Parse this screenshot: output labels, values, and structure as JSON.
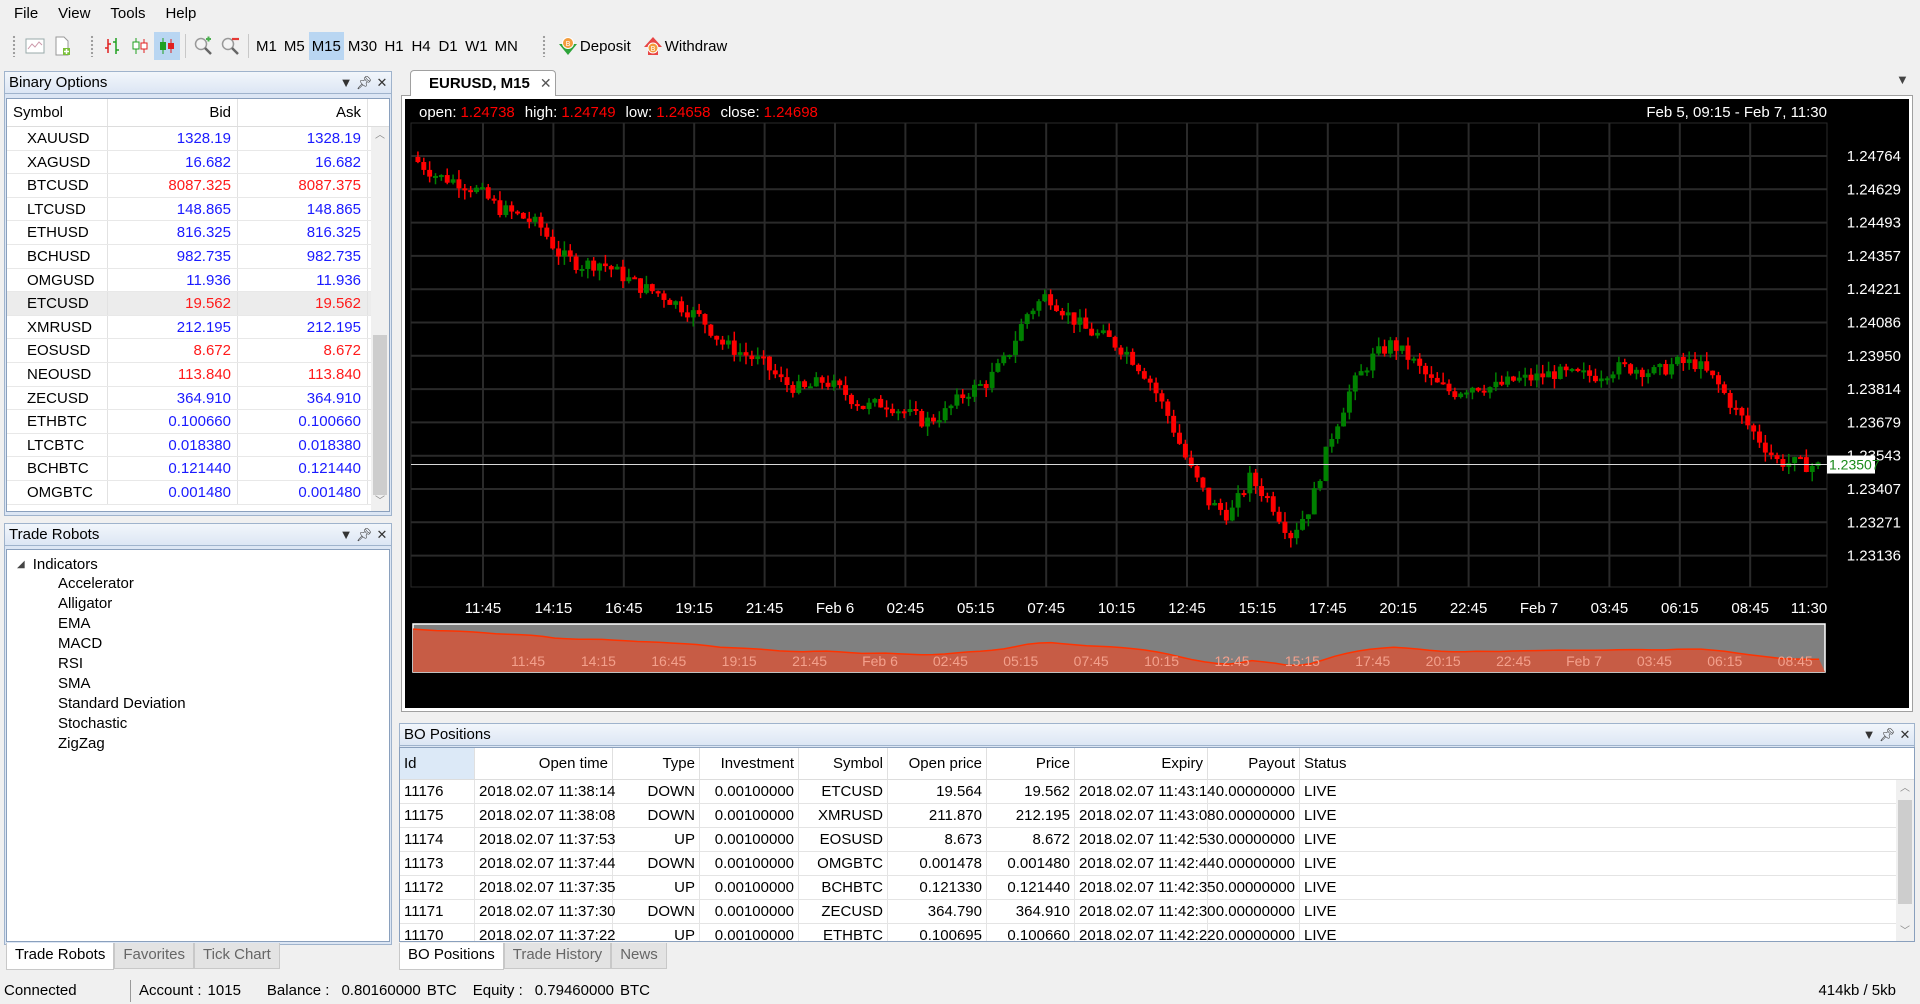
{
  "menu": [
    "File",
    "View",
    "Tools",
    "Help"
  ],
  "toolbar": {
    "icons": [
      "new-chart-icon",
      "new-file-icon",
      "bar-chart-icon",
      "candlestick-hollow-icon",
      "candlestick-icon",
      "zoom-in-icon",
      "zoom-out-icon"
    ],
    "timeframes": [
      "M1",
      "M5",
      "M15",
      "M30",
      "H1",
      "H4",
      "D1",
      "W1",
      "MN"
    ],
    "active_timeframe": "M15",
    "deposit_label": "Deposit",
    "withdraw_label": "Withdraw"
  },
  "binary_options": {
    "title": "Binary Options",
    "columns": [
      "Symbol",
      "Bid",
      "Ask"
    ],
    "selected_symbol": "ETCUSD",
    "rows": [
      {
        "symbol": "XAUUSD",
        "bid": "1328.19",
        "ask": "1328.19",
        "dir": "up"
      },
      {
        "symbol": "XAGUSD",
        "bid": "16.682",
        "ask": "16.682",
        "dir": "up"
      },
      {
        "symbol": "BTCUSD",
        "bid": "8087.325",
        "ask": "8087.375",
        "dir": "down"
      },
      {
        "symbol": "LTCUSD",
        "bid": "148.865",
        "ask": "148.865",
        "dir": "up"
      },
      {
        "symbol": "ETHUSD",
        "bid": "816.325",
        "ask": "816.325",
        "dir": "up"
      },
      {
        "symbol": "BCHUSD",
        "bid": "982.735",
        "ask": "982.735",
        "dir": "up"
      },
      {
        "symbol": "OMGUSD",
        "bid": "11.936",
        "ask": "11.936",
        "dir": "up"
      },
      {
        "symbol": "ETCUSD",
        "bid": "19.562",
        "ask": "19.562",
        "dir": "down"
      },
      {
        "symbol": "XMRUSD",
        "bid": "212.195",
        "ask": "212.195",
        "dir": "up"
      },
      {
        "symbol": "EOSUSD",
        "bid": "8.672",
        "ask": "8.672",
        "dir": "down"
      },
      {
        "symbol": "NEOUSD",
        "bid": "113.840",
        "ask": "113.840",
        "dir": "down"
      },
      {
        "symbol": "ZECUSD",
        "bid": "364.910",
        "ask": "364.910",
        "dir": "up"
      },
      {
        "symbol": "ETHBTC",
        "bid": "0.100660",
        "ask": "0.100660",
        "dir": "up"
      },
      {
        "symbol": "LTCBTC",
        "bid": "0.018380",
        "ask": "0.018380",
        "dir": "up"
      },
      {
        "symbol": "BCHBTC",
        "bid": "0.121440",
        "ask": "0.121440",
        "dir": "up"
      },
      {
        "symbol": "OMGBTC",
        "bid": "0.001480",
        "ask": "0.001480",
        "dir": "up"
      }
    ]
  },
  "trade_robots": {
    "title": "Trade Robots",
    "root": "Indicators",
    "items": [
      "Accelerator",
      "Alligator",
      "EMA",
      "MACD",
      "RSI",
      "SMA",
      "Standard Deviation",
      "Stochastic",
      "ZigZag"
    ]
  },
  "left_tabs": [
    {
      "label": "Trade Robots",
      "active": true
    },
    {
      "label": "Favorites",
      "active": false
    },
    {
      "label": "Tick Chart",
      "active": false
    }
  ],
  "chart": {
    "tab_label": "EURUSD, M15",
    "ohlc": {
      "open_label": "open:",
      "open": "1.24738",
      "high_label": "high:",
      "high": "1.24749",
      "low_label": "low:",
      "low": "1.24658",
      "close_label": "close:",
      "close": "1.24698"
    },
    "range_label": "Feb 5, 09:15 - Feb 7, 11:30",
    "current_price": "1.23507",
    "colors": {
      "up": "#008000",
      "down": "#ff0000",
      "background": "#000000",
      "grid": "#2a2a2a",
      "navigator_fill": "#c75c45",
      "navigator_line": "#ff3300",
      "navigator_bg": "#808080"
    }
  },
  "chart_data": {
    "type": "candlestick",
    "title": "EURUSD, M15",
    "y_ticks": [
      "1.24764",
      "1.24629",
      "1.24493",
      "1.24357",
      "1.24221",
      "1.24086",
      "1.23950",
      "1.23814",
      "1.23679",
      "1.23543",
      "1.23407",
      "1.23271",
      "1.23136"
    ],
    "ylim": [
      1.23,
      1.249
    ],
    "x_ticks": [
      "11:45",
      "14:15",
      "16:45",
      "19:15",
      "21:45",
      "Feb 6",
      "02:45",
      "05:15",
      "07:45",
      "10:15",
      "12:45",
      "15:15",
      "17:45",
      "20:15",
      "22:45",
      "Feb 7",
      "03:45",
      "06:15",
      "08:45",
      "11:30"
    ],
    "last_price": 1.23507,
    "close_path": [
      1.2474,
      1.2468,
      1.2466,
      1.2462,
      1.2455,
      1.2452,
      1.2448,
      1.2436,
      1.2432,
      1.2433,
      1.2428,
      1.2423,
      1.242,
      1.2415,
      1.241,
      1.24,
      1.2396,
      1.2392,
      1.2384,
      1.2381,
      1.2385,
      1.238,
      1.2374,
      1.2376,
      1.2372,
      1.2368,
      1.2372,
      1.238,
      1.2384,
      1.2394,
      1.2412,
      1.242,
      1.2412,
      1.2405,
      1.2402,
      1.2396,
      1.2386,
      1.237,
      1.235,
      1.2335,
      1.233,
      1.2345,
      1.2336,
      1.2322,
      1.2334,
      1.2362,
      1.2382,
      1.2394,
      1.24,
      1.2393,
      1.2384,
      1.238,
      1.2383,
      1.2382,
      1.2385,
      1.2386,
      1.2388,
      1.2387,
      1.2387,
      1.239,
      1.239,
      1.2388,
      1.2392,
      1.2392,
      1.2384,
      1.2372,
      1.2362,
      1.2352,
      1.2351,
      1.235
    ]
  },
  "bo_positions": {
    "title": "BO Positions",
    "columns": [
      "Id",
      "Open time",
      "Type",
      "Investment",
      "Symbol",
      "Open price",
      "Price",
      "Expiry",
      "Payout",
      "Status"
    ],
    "sorted_column": "Id",
    "rows": [
      [
        "11176",
        "2018.02.07 11:38:14",
        "DOWN",
        "0.00100000",
        "ETCUSD",
        "19.564",
        "19.562",
        "2018.02.07 11:43:14",
        "0.00000000",
        "LIVE"
      ],
      [
        "11175",
        "2018.02.07 11:38:08",
        "DOWN",
        "0.00100000",
        "XMRUSD",
        "211.870",
        "212.195",
        "2018.02.07 11:43:08",
        "0.00000000",
        "LIVE"
      ],
      [
        "11174",
        "2018.02.07 11:37:53",
        "UP",
        "0.00100000",
        "EOSUSD",
        "8.673",
        "8.672",
        "2018.02.07 11:42:53",
        "0.00000000",
        "LIVE"
      ],
      [
        "11173",
        "2018.02.07 11:37:44",
        "DOWN",
        "0.00100000",
        "OMGBTC",
        "0.001478",
        "0.001480",
        "2018.02.07 11:42:44",
        "0.00000000",
        "LIVE"
      ],
      [
        "11172",
        "2018.02.07 11:37:35",
        "UP",
        "0.00100000",
        "BCHBTC",
        "0.121330",
        "0.121440",
        "2018.02.07 11:42:35",
        "0.00000000",
        "LIVE"
      ],
      [
        "11171",
        "2018.02.07 11:37:30",
        "DOWN",
        "0.00100000",
        "ZECUSD",
        "364.790",
        "364.910",
        "2018.02.07 11:42:30",
        "0.00000000",
        "LIVE"
      ],
      [
        "11170",
        "2018.02.07 11:37:22",
        "UP",
        "0.00100000",
        "ETHBTC",
        "0.100695",
        "0.100660",
        "2018.02.07 11:42:22",
        "0.00000000",
        "LIVE"
      ]
    ]
  },
  "bottom_tabs": [
    {
      "label": "BO Positions",
      "active": true
    },
    {
      "label": "Trade History",
      "active": false
    },
    {
      "label": "News",
      "active": false
    }
  ],
  "status": {
    "connection": "Connected",
    "account_label": "Account :",
    "account": "1015",
    "balance_label": "Balance :",
    "balance": "0.80160000",
    "balance_currency": "BTC",
    "equity_label": "Equity :",
    "equity": "0.79460000",
    "equity_currency": "BTC",
    "traffic": "414kb / 5kb"
  }
}
